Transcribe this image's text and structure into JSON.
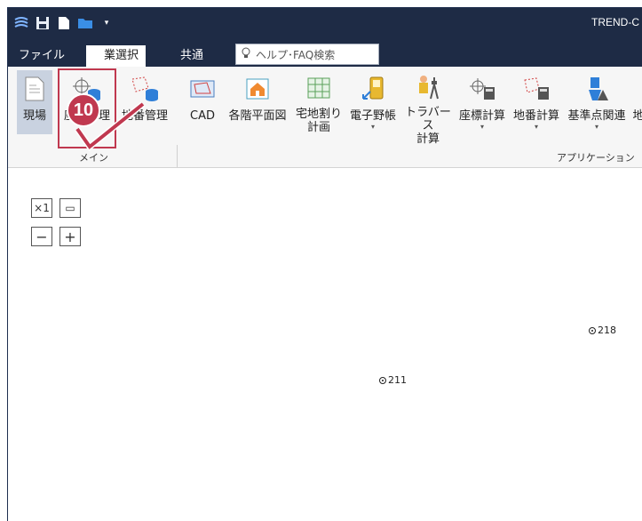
{
  "window": {
    "title": "TREND-C"
  },
  "quick_access": [
    {
      "name": "app-logo-icon"
    },
    {
      "name": "save-icon"
    },
    {
      "name": "new-file-icon"
    },
    {
      "name": "open-folder-icon"
    },
    {
      "name": "customize-dropdown-icon"
    }
  ],
  "tabs": [
    {
      "label": "ファイル"
    },
    {
      "label": "業選択"
    },
    {
      "label": "共通"
    }
  ],
  "search": {
    "placeholder": "ヘルプ･FAQ検索"
  },
  "ribbon": {
    "main_group": {
      "label": "メイン",
      "buttons": [
        {
          "label": "現場"
        },
        {
          "label": "座標管理"
        },
        {
          "label": "地番管理"
        }
      ]
    },
    "app_group": {
      "label": "アプリケーション",
      "buttons": [
        {
          "label": "CAD"
        },
        {
          "label": "各階平面図"
        },
        {
          "label": "宅地割り\n計画"
        },
        {
          "label": "電子野帳"
        },
        {
          "label": "トラバース\n計算"
        },
        {
          "label": "座標計算"
        },
        {
          "label": "地番計算"
        },
        {
          "label": "基準点関連"
        },
        {
          "label": "地"
        }
      ]
    }
  },
  "callout": {
    "number": "10"
  },
  "canvas": {
    "zoom_buttons": [
      {
        "label": "×1"
      },
      {
        "label": "▭"
      },
      {
        "label": "−"
      },
      {
        "label": "+"
      }
    ],
    "points": [
      {
        "label": "218"
      },
      {
        "label": "211"
      }
    ]
  },
  "colors": {
    "titlebar": "#1e2b45",
    "highlight": "#c0384f",
    "selected": "#c9d2e0"
  }
}
